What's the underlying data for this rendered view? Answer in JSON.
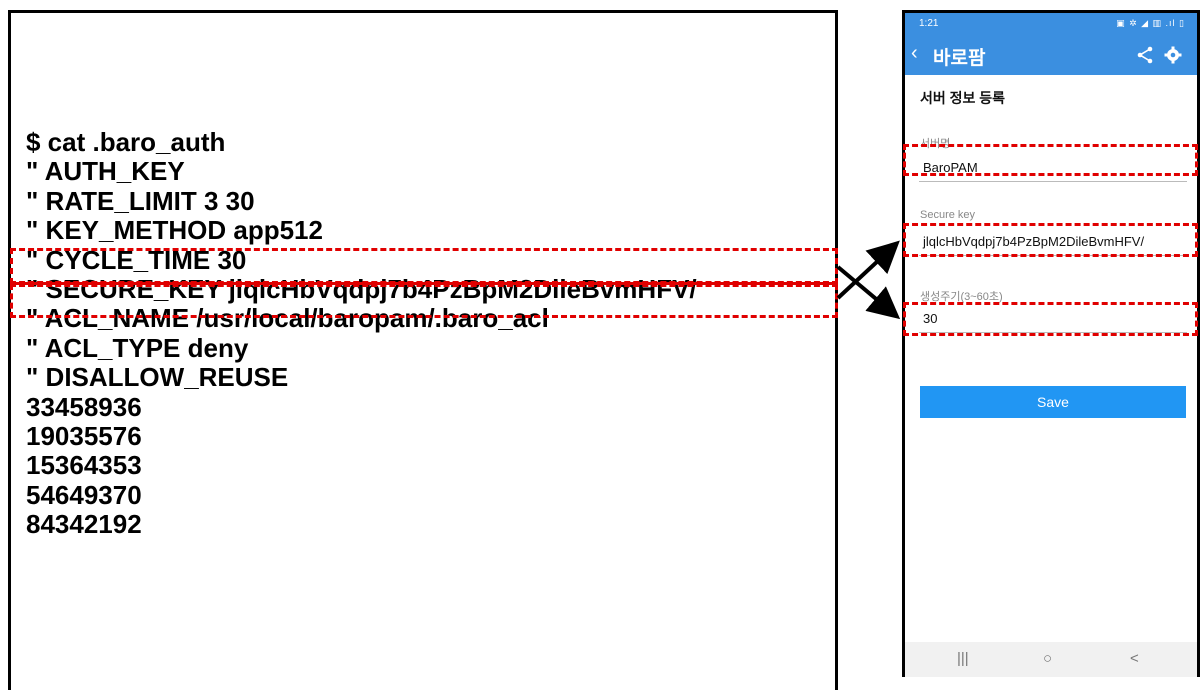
{
  "terminal": {
    "lines": [
      "$ cat .baro_auth",
      "\" AUTH_KEY",
      "\" RATE_LIMIT 3 30",
      "\" KEY_METHOD app512",
      "\" CYCLE_TIME 30",
      "\" SECURE_KEY jlqlcHbVqdpj7b4PzBpM2DileBvmHFV/",
      "\" ACL_NAME /usr/local/baropam/.baro_acl",
      "\" ACL_TYPE deny",
      "\" DISALLOW_REUSE",
      "33458936",
      "19035576",
      "15364353",
      "54649370",
      "84342192"
    ]
  },
  "phone": {
    "status_time": "1:21",
    "status_icons": "▣ ✲ ◢ ▥ .ıl ▯",
    "app_title": "바로팜",
    "section_title": "서버 정보 등록",
    "server_name_label": "서버명",
    "server_name_value": "BaroPAM",
    "secure_key_label": "Secure key",
    "secure_key_value": "jlqlcHbVqdpj7b4PzBpM2DileBvmHFV/",
    "cycle_label": "생성주기(3~60초)",
    "cycle_value": "30",
    "save_label": "Save",
    "nav_recent": "|||",
    "nav_home": "○",
    "nav_back": "<"
  },
  "colors": {
    "accent": "#3b8fe0",
    "button": "#2196f3",
    "highlight": "#e00000"
  }
}
